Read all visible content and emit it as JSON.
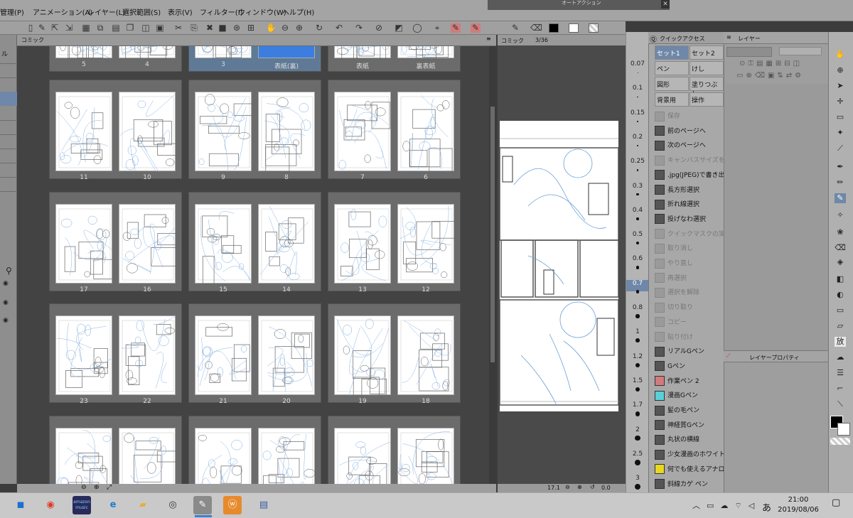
{
  "menu": [
    "管理(P)",
    "アニメーション(A)",
    "レイヤー(L)",
    "選択範囲(S)",
    "表示(V)",
    "フィルター(I)",
    "ウィンドウ(W)",
    "ヘルプ(H)"
  ],
  "autoaction_title": "オートアクション",
  "comic_tab": "コミック",
  "spread_rows": [
    [
      "5",
      "4",
      "3",
      "表紙(裏)",
      "表紙",
      "裏表紙"
    ],
    [
      "11",
      "10",
      "9",
      "8",
      "7",
      "6"
    ],
    [
      "17",
      "16",
      "15",
      "14",
      "13",
      "12"
    ],
    [
      "23",
      "22",
      "21",
      "20",
      "19",
      "18"
    ]
  ],
  "pageview": {
    "tab": "コミック",
    "page": "3/36",
    "zoom": "17.1",
    "angle": "0.0"
  },
  "ruler_values": [
    "0.07",
    "0.1",
    "0.15",
    "0.2",
    "0.25",
    "0.3",
    "0.4",
    "0.5",
    "0.6",
    "0.7",
    "0.8",
    "1",
    "1.2",
    "1.5",
    "1.7",
    "2",
    "2.5",
    "3"
  ],
  "quick": {
    "tab": "クイックアクセス",
    "grid": [
      "セット1",
      "セット2",
      "ペン",
      "けし",
      "図形",
      "塗りつぶし",
      "背景用",
      "操作"
    ],
    "items": [
      {
        "label": "保存",
        "dim": true
      },
      {
        "label": "前のページへ",
        "dim": false
      },
      {
        "label": "次のページへ",
        "dim": false
      },
      {
        "label": "キャンバスサイズを選",
        "dim": true
      },
      {
        "label": ".jpg(JPEG)で書き出",
        "dim": false
      },
      {
        "label": "長方形選択",
        "dim": false
      },
      {
        "label": "折れ線選択",
        "dim": false
      },
      {
        "label": "投げなわ選択",
        "dim": false
      },
      {
        "label": "クイックマスクの実行",
        "dim": true
      },
      {
        "label": "取り消し",
        "dim": true
      },
      {
        "label": "やり直し",
        "dim": true
      },
      {
        "label": "再選択",
        "dim": true
      },
      {
        "label": "選択を解除",
        "dim": true
      },
      {
        "label": "切り取り",
        "dim": true
      },
      {
        "label": "コピー",
        "dim": true
      },
      {
        "label": "貼り付け",
        "dim": true
      },
      {
        "label": "リアルGペン",
        "dim": false
      },
      {
        "label": "Gペン",
        "dim": false
      },
      {
        "label": "作業ペン 2",
        "dim": false
      },
      {
        "label": "漫画Gペン",
        "dim": false
      },
      {
        "label": "髪の毛ペン",
        "dim": false
      },
      {
        "label": "神経質Gペン",
        "dim": false
      },
      {
        "label": "丸状の横線",
        "dim": false
      },
      {
        "label": "少女漫画のホワイト",
        "dim": false
      },
      {
        "label": "何でも使えるアナロ",
        "dim": false
      },
      {
        "label": "斜線カゲ ペン",
        "dim": false
      }
    ]
  },
  "layer": {
    "tab": "レイヤー",
    "prop_tab": "レイヤープロパティ"
  },
  "taskbar": {
    "time": "21:00",
    "date": "2019/08/06",
    "ime": "あ",
    "apps": [
      "start",
      "chrome",
      "amazon-music",
      "edge",
      "explorer",
      "clip-studio-paint",
      "clip-studio",
      "webtoon",
      "app"
    ],
    "amazon_label": "amazon music"
  },
  "colors": {
    "selected_tab": "#6f87a8",
    "cover_blue": "#3b7ee0"
  }
}
